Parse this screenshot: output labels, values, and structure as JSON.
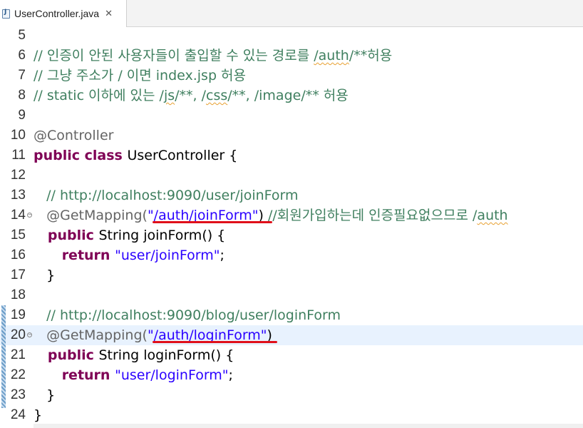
{
  "tab": {
    "title": "UserController.java",
    "close": "✕"
  },
  "lines": [
    {
      "num": "5",
      "segments": []
    },
    {
      "num": "6",
      "segments": [
        {
          "t": "// 인증이 안된 사용자들이 출입할 수 있는 경로를 ",
          "c": "comment"
        },
        {
          "t": "/auth",
          "c": "comment squig"
        },
        {
          "t": "/**허용",
          "c": "comment"
        }
      ]
    },
    {
      "num": "7",
      "segments": [
        {
          "t": "// 그냥 주소가 / 이면 index.jsp 허용",
          "c": "comment"
        }
      ]
    },
    {
      "num": "8",
      "segments": [
        {
          "t": "// static 이하에 있는 /",
          "c": "comment"
        },
        {
          "t": "js",
          "c": "comment squig"
        },
        {
          "t": "/**, /",
          "c": "comment"
        },
        {
          "t": "css",
          "c": "comment squig"
        },
        {
          "t": "/**, /image/** 허용",
          "c": "comment"
        }
      ]
    },
    {
      "num": "9",
      "segments": []
    },
    {
      "num": "10",
      "segments": [
        {
          "t": "@Controller",
          "c": "ann"
        }
      ]
    },
    {
      "num": "11",
      "segments": [
        {
          "t": "public class ",
          "c": "kw"
        },
        {
          "t": "UserController {",
          "c": "plain"
        }
      ]
    },
    {
      "num": "12",
      "segments": []
    },
    {
      "num": "13",
      "segments": [
        {
          "t": "   // http://localhost:9090/user/joinForm",
          "c": "comment"
        }
      ]
    },
    {
      "num": "14",
      "fold": true,
      "segments": [
        {
          "t": "   @GetMapping(",
          "c": "ann"
        },
        {
          "t": "\"/auth/joinForm\"",
          "c": "str"
        },
        {
          "t": ") ",
          "c": "plain"
        },
        {
          "t": "//회원가입하는데 인증필요없으므로 /",
          "c": "comment"
        },
        {
          "t": "auth",
          "c": "comment squig"
        }
      ]
    },
    {
      "num": "15",
      "segments": [
        {
          "t": "   public ",
          "c": "kw"
        },
        {
          "t": "String joinForm() {",
          "c": "plain"
        }
      ]
    },
    {
      "num": "16",
      "segments": [
        {
          "t": "      return ",
          "c": "kw"
        },
        {
          "t": "\"user/joinForm\"",
          "c": "str"
        },
        {
          "t": ";",
          "c": "plain"
        }
      ]
    },
    {
      "num": "17",
      "segments": [
        {
          "t": "   }",
          "c": "plain"
        }
      ]
    },
    {
      "num": "18",
      "segments": []
    },
    {
      "num": "19",
      "segments": [
        {
          "t": "   // http://localhost:9090/blog/user/loginForm",
          "c": "comment"
        }
      ]
    },
    {
      "num": "20",
      "fold": true,
      "current": true,
      "segments": [
        {
          "t": "   @GetMapping(",
          "c": "ann"
        },
        {
          "t": "\"/auth/loginForm\"",
          "c": "str"
        },
        {
          "t": ")",
          "c": "plain"
        }
      ]
    },
    {
      "num": "21",
      "segments": [
        {
          "t": "   public ",
          "c": "kw"
        },
        {
          "t": "String loginForm() {",
          "c": "plain"
        }
      ]
    },
    {
      "num": "22",
      "segments": [
        {
          "t": "      return ",
          "c": "kw"
        },
        {
          "t": "\"user/loginForm\"",
          "c": "str"
        },
        {
          "t": ";",
          "c": "plain"
        }
      ]
    },
    {
      "num": "23",
      "segments": [
        {
          "t": "   }",
          "c": "plain"
        }
      ]
    },
    {
      "num": "24",
      "segments": [
        {
          "t": "}",
          "c": "plain"
        }
      ]
    }
  ]
}
